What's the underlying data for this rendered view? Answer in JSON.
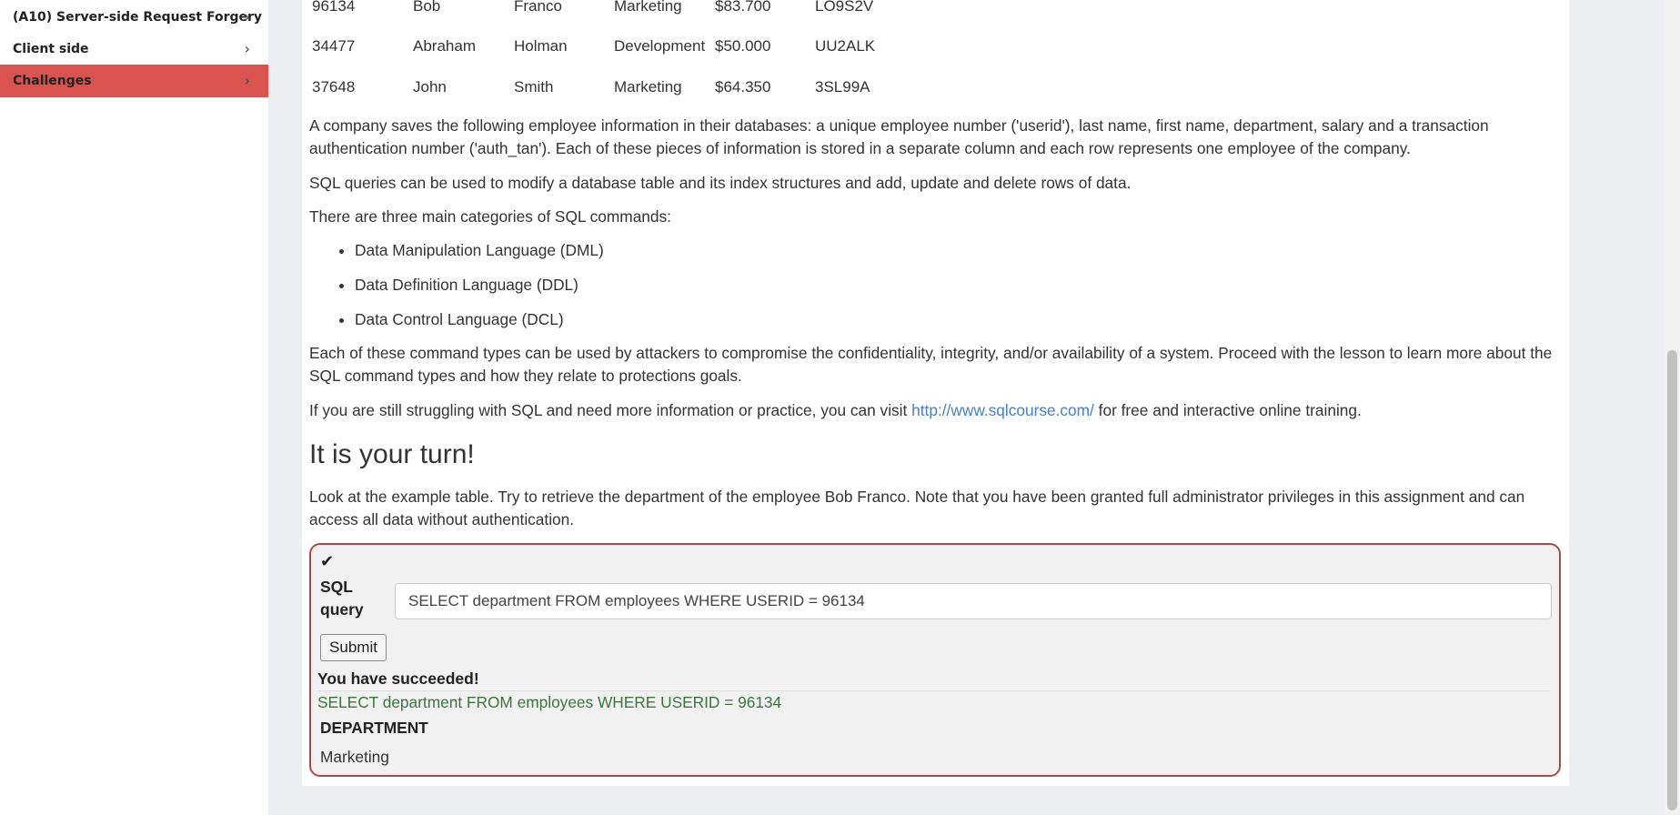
{
  "sidebar": {
    "items": [
      {
        "label": "(A10) Server-side Request Forgery",
        "chevron": "›"
      },
      {
        "label": "Client side",
        "chevron": "›"
      },
      {
        "label": "Challenges",
        "chevron": "›",
        "active": true
      }
    ]
  },
  "table": {
    "rows": [
      [
        "96134",
        "Bob",
        "Franco",
        "Marketing",
        "$83.700",
        "LO9S2V"
      ],
      [
        "34477",
        "Abraham",
        "Holman",
        "Development",
        "$50.000",
        "UU2ALK"
      ],
      [
        "37648",
        "John",
        "Smith",
        "Marketing",
        "$64.350",
        "3SL99A"
      ]
    ]
  },
  "content": {
    "p1": "A company saves the following employee information in their databases: a unique employee number ('userid'), last name, first name, department, salary and a transaction authentication number ('auth_tan'). Each of these pieces of information is stored in a separate column and each row represents one employee of the company.",
    "p2": "SQL queries can be used to modify a database table and its index structures and add, update and delete rows of data.",
    "p3": "There are three main categories of SQL commands:",
    "categories": [
      "Data Manipulation Language (DML)",
      "Data Definition Language (DDL)",
      "Data Control Language (DCL)"
    ],
    "p4": "Each of these command types can be used by attackers to compromise the confidentiality, integrity, and/or availability of a system. Proceed with the lesson to learn more about the SQL command types and how they relate to protections goals.",
    "p5_pre": "If you are still struggling with SQL and need more information or practice, you can visit ",
    "p5_link": "http://www.sqlcourse.com/",
    "p5_post": " for free and interactive online training.",
    "heading": "It is your turn!",
    "p6": "Look at the example table. Try to retrieve the department of the employee Bob Franco. Note that you have been granted full administrator privileges in this assignment and can access all data without authentication."
  },
  "assignment": {
    "check_icon": "✔",
    "sql_label": "SQL query",
    "sql_value": "SELECT department FROM employees WHERE USERID = 96134",
    "submit_label": "Submit",
    "success": "You have succeeded!",
    "query_echo": "SELECT department FROM employees WHERE USERID = 96134",
    "result_header": "DEPARTMENT",
    "result_value": "Marketing"
  },
  "colors": {
    "active_sidebar": "#d9534f",
    "box_border": "#a84a4a",
    "success_text": "#3c763d",
    "link": "#4a7fc1"
  }
}
